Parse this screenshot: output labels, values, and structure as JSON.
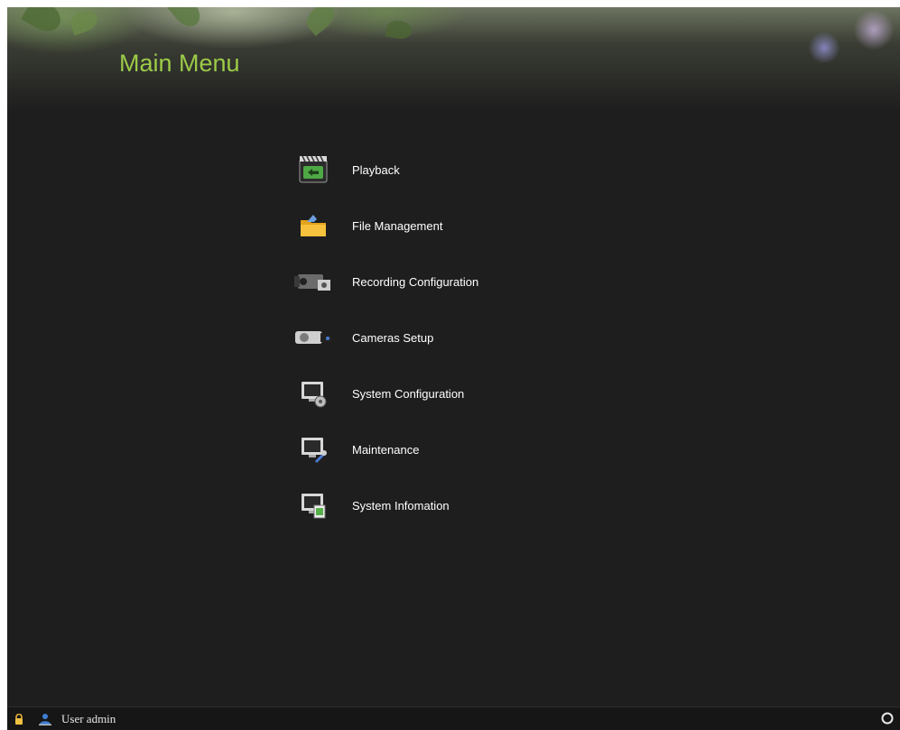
{
  "header": {
    "title": "Main Menu"
  },
  "menu": {
    "items": [
      {
        "label": "Playback",
        "icon": "playback-icon"
      },
      {
        "label": "File Management",
        "icon": "folder-icon"
      },
      {
        "label": "Recording Configuration",
        "icon": "recorder-icon"
      },
      {
        "label": "Cameras Setup",
        "icon": "camera-icon"
      },
      {
        "label": "System Configuration",
        "icon": "monitor-gear-icon"
      },
      {
        "label": "Maintenance",
        "icon": "monitor-wrench-icon"
      },
      {
        "label": "System Infomation",
        "icon": "monitor-info-icon"
      }
    ]
  },
  "statusbar": {
    "user_text": "User admin",
    "icons": [
      "lock-icon",
      "user-icon",
      "power-icon"
    ]
  },
  "colors": {
    "title": "#9ccb47",
    "background": "#1e1e1e",
    "text": "#ffffff"
  }
}
